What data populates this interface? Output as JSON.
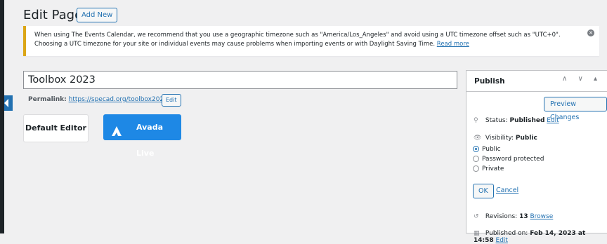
{
  "header": {
    "title": "Edit Page",
    "add_new": "Add New"
  },
  "notice": {
    "line1": "When using The Events Calendar, we recommend that you use a geographic timezone such as \"America/Los_Angeles\" and avoid using a UTC timezone offset such as \"UTC+0\".",
    "line2": "Choosing a UTC timezone for your site or individual events may cause problems when importing events or with Daylight Saving Time.",
    "link": "Read more",
    "accent": "#dba617"
  },
  "editor": {
    "title_value": "Toolbox 2023",
    "permalink_label": "Permalink:",
    "permalink_url": "https://specad.org/toolbox2023/",
    "permalink_edit": "Edit",
    "default_editor": "Default Editor",
    "avada_live": "Avada Live",
    "avada_color": "#1e88e5"
  },
  "publish": {
    "title": "Publish",
    "arrows": "∧ ∨ ▴",
    "preview": "Preview Changes",
    "status_label": "Status:",
    "status_value": "Published",
    "status_edit": "Edit",
    "visibility_label": "Visibility:",
    "visibility_value": "Public",
    "options": [
      "Public",
      "Password protected",
      "Private"
    ],
    "selected": "Public",
    "ok": "OK",
    "cancel": "Cancel",
    "revisions_label": "Revisions:",
    "revisions_count": "13",
    "revisions_link": "Browse",
    "published_label": "Published on:",
    "published_date": "Feb 14, 2023 at 14:58",
    "published_edit": "Edit"
  }
}
